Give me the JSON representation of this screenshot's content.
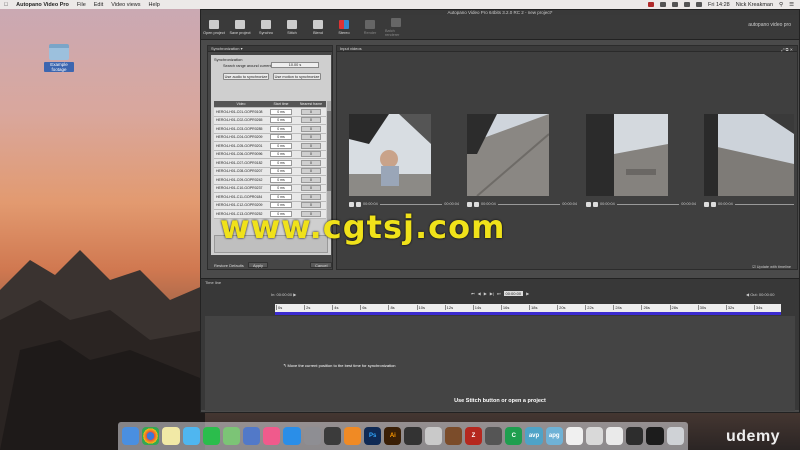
{
  "menubar": {
    "app_name": "Autopano Video Pro",
    "items": [
      "File",
      "Edit",
      "Video views",
      "Help"
    ],
    "time": "Fri 14:28",
    "user": "Nick Kreakman"
  },
  "desktop": {
    "icon_label": "Example footage"
  },
  "window": {
    "title": "Autopano Video Pro 64bits 3.2.0 RC 2 - new project*",
    "brand": "autopano video pro",
    "toolbar": [
      {
        "label": "Open project",
        "icon": "folder-icon"
      },
      {
        "label": "Save project",
        "icon": "save-icon"
      },
      {
        "label": "Synchro",
        "icon": "clapper-icon"
      },
      {
        "label": "Stitch",
        "icon": "stitch-icon"
      },
      {
        "label": "Blend",
        "icon": "blend-icon"
      },
      {
        "label": "Stereo",
        "icon": "stereo-icon"
      },
      {
        "label": "Render",
        "icon": "gear-icon"
      },
      {
        "label": "Batch renderer",
        "icon": "gear-icon"
      }
    ]
  },
  "sync_panel": {
    "header": "Synchronization",
    "section": "Synchronization",
    "range_label": "Search range around current time:",
    "range_value": "10.00 s",
    "btn_audio": "Use audio to synchronize",
    "btn_motion": "Use motion to synchronize",
    "columns": [
      "Video",
      "Start time",
      "Nearest frame"
    ],
    "rows": [
      {
        "video": "HERO4-H01-C01-GOPR0108",
        "start": "0 ms",
        "frame": "0"
      },
      {
        "video": "HERO4-H01-C02-GOPR0265",
        "start": "0 ms",
        "frame": "0"
      },
      {
        "video": "HERO4-H01-C03-GOPR0285",
        "start": "0 ms",
        "frame": "0"
      },
      {
        "video": "HERO4-H01-C04-GOPR0209",
        "start": "0 ms",
        "frame": "0"
      },
      {
        "video": "HERO4-H01-C05-GOPR0201",
        "start": "0 ms",
        "frame": "0"
      },
      {
        "video": "HERO4-H01-C06-GOPR0096",
        "start": "0 ms",
        "frame": "0"
      },
      {
        "video": "HERO4-H01-C07-GOPR0182",
        "start": "0 ms",
        "frame": "0"
      },
      {
        "video": "HERO4-H01-C08-GOPR0207",
        "start": "0 ms",
        "frame": "0"
      },
      {
        "video": "HERO4-H01-C09-GOPR0242",
        "start": "0 ms",
        "frame": "0"
      },
      {
        "video": "HERO4-H01-C10-GOPR0237",
        "start": "0 ms",
        "frame": "0"
      },
      {
        "video": "HERO4-H01-C11-GOPR0184",
        "start": "0 ms",
        "frame": "0"
      },
      {
        "video": "HERO4-H01-C12-GOPR0209",
        "start": "0 ms",
        "frame": "0"
      },
      {
        "video": "HERO4-H01-C13-GOPR0252",
        "start": "0 ms",
        "frame": "0"
      }
    ],
    "restore": "Restore Defaults",
    "apply": "Apply",
    "cancel": "Cancel"
  },
  "input_panel": {
    "header": "Input videos",
    "timecode": "00:00:04",
    "update_label": "Update with timeline"
  },
  "timeline": {
    "label": "Time line",
    "in_label": "In: 00:00:00",
    "out_label": "Out: 00:00:00",
    "current": "00:00:00",
    "ticks": [
      "0s",
      "2s",
      "4s",
      "6s",
      "8s",
      "10s",
      "12s",
      "14s",
      "16s",
      "18s",
      "20s",
      "22s",
      "24s",
      "26s",
      "28s",
      "30s",
      "32s",
      "34s"
    ],
    "hint": "Move the current position to the best time for synchronization",
    "center_msg": "Use Stitch button or open a project"
  },
  "watermark": "www.cgtsj.com",
  "udemy": "udemy",
  "dock": [
    "finder",
    "chrome",
    "notes",
    "messages",
    "facetime",
    "maps",
    "keynote",
    "itunes",
    "appstore",
    "prefs",
    "fcp",
    "vlc",
    "ps",
    "ai",
    "cinema",
    "photos",
    "mplayer",
    "filezilla",
    "tool",
    "camtasia",
    "avp",
    "apg",
    "doc",
    "archive",
    "preview",
    "calc",
    "terminal",
    "trash"
  ]
}
